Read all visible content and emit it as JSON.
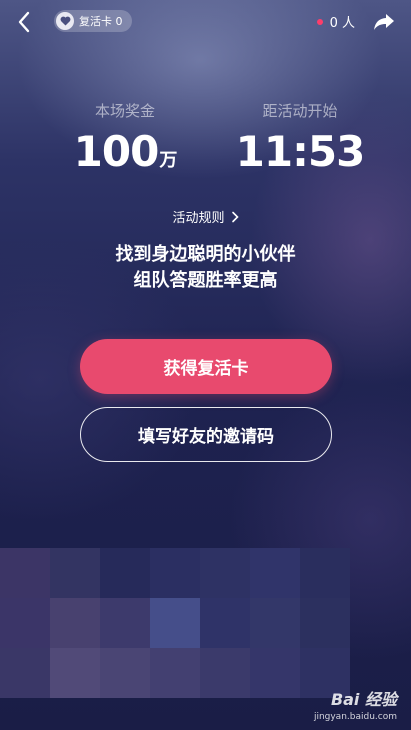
{
  "topbar": {
    "back_icon": "chevron-left-icon",
    "revive_card_label": "复活卡 0",
    "online_count": "0 人",
    "online_dot_color": "#ff3d6a",
    "share_icon": "share-arrow-icon"
  },
  "stats": {
    "prize_label": "本场奖金",
    "prize_value": "100",
    "prize_unit": "万",
    "countdown_label": "距活动开始",
    "countdown_value": "11:53"
  },
  "rules_link": "活动规则",
  "slogan": {
    "line1": "找到身边聪明的小伙伴",
    "line2": "组队答题胜率更高"
  },
  "buttons": {
    "get_revive_card": "获得复活卡",
    "enter_invite_code": "填写好友的邀请码"
  },
  "colors": {
    "accent": "#e84a6e",
    "background": "#1f2350"
  },
  "watermark": {
    "brand": "Bai  经验",
    "url": "jingyan.baidu.com"
  }
}
